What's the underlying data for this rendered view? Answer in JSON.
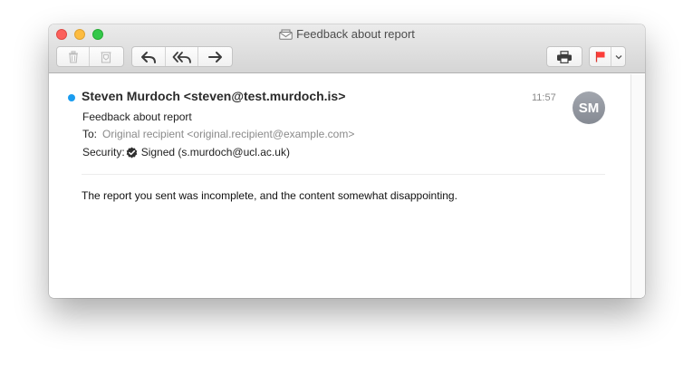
{
  "window": {
    "title": "Feedback about report"
  },
  "toolbar": {
    "buttons": [
      {
        "name": "delete",
        "icon": "trash-icon"
      },
      {
        "name": "junk",
        "icon": "junk-icon"
      },
      {
        "name": "reply",
        "icon": "reply-icon"
      },
      {
        "name": "reply-all",
        "icon": "reply-all-icon"
      },
      {
        "name": "forward",
        "icon": "forward-icon"
      },
      {
        "name": "print",
        "icon": "printer-icon"
      },
      {
        "name": "flag",
        "icon": "flag-icon"
      },
      {
        "name": "flag-menu",
        "icon": "chevron-down-icon"
      }
    ]
  },
  "message": {
    "unread": true,
    "sender": "Steven Murdoch <steven@test.murdoch.is>",
    "time": "11:57",
    "avatar_initials": "SM",
    "subject": "Feedback about report",
    "to_label": "To:",
    "to_value": "Original recipient <original.recipient@example.com>",
    "security_label": "Security:",
    "security_value": "Signed (s.murdoch@ucl.ac.uk)",
    "body": "The report you sent was incomplete, and the content somewhat disappointing."
  },
  "colors": {
    "unread_dot": "#1a9cf0",
    "flag": "#fc3d39",
    "avatar": "#979ba3"
  }
}
